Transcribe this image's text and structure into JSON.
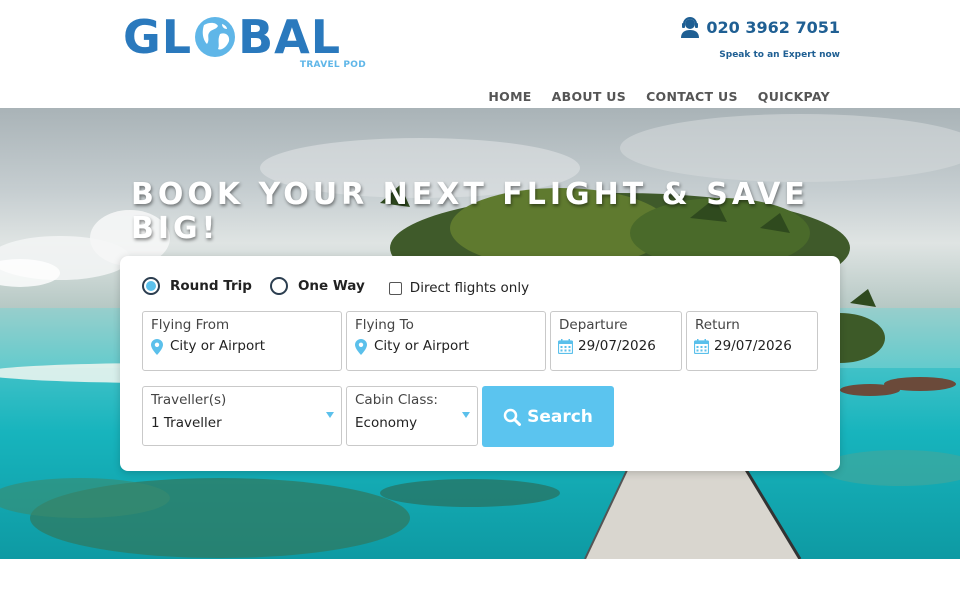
{
  "brand": {
    "logo_left": "GL",
    "logo_right": "BAL",
    "tagline": "TRAVEL POD",
    "primary_color": "#2a79bd",
    "accent_color": "#5bc4ef"
  },
  "contact": {
    "phone": "020 3962 7051",
    "subtitle": "Speak to an Expert now",
    "icon": "headset-agent-icon"
  },
  "nav": {
    "items": [
      {
        "label": "HOME"
      },
      {
        "label": "ABOUT US"
      },
      {
        "label": "CONTACT US"
      },
      {
        "label": "QUICKPAY"
      }
    ]
  },
  "hero": {
    "title": "BOOK YOUR NEXT FLIGHT & SAVE BIG!"
  },
  "search": {
    "trip_types": [
      {
        "label": "Round Trip",
        "selected": true
      },
      {
        "label": "One Way",
        "selected": false
      }
    ],
    "direct_only": {
      "label": "Direct flights only",
      "checked": false
    },
    "flying_from": {
      "label": "Flying From",
      "value": "City or Airport",
      "icon": "map-pin-icon"
    },
    "flying_to": {
      "label": "Flying To",
      "value": "City or Airport",
      "icon": "map-pin-icon"
    },
    "departure": {
      "label": "Departure",
      "value": "29/07/2026",
      "icon": "calendar-icon"
    },
    "return": {
      "label": "Return",
      "value": "29/07/2026",
      "icon": "calendar-icon"
    },
    "travellers": {
      "label": "Traveller(s)",
      "value": "1 Traveller"
    },
    "cabin_class": {
      "label": "Cabin Class:",
      "value": "Economy"
    },
    "submit": {
      "label": "Search",
      "icon": "search-icon"
    }
  }
}
